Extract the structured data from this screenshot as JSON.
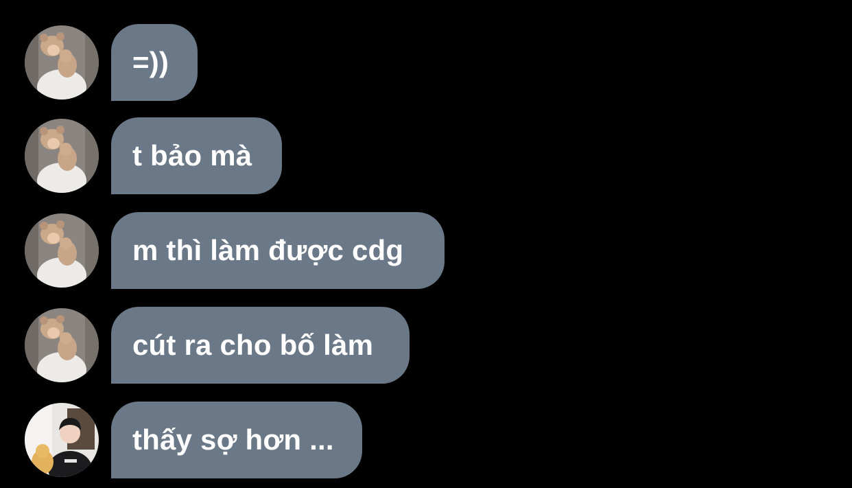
{
  "messages": [
    {
      "text": "=))",
      "avatar": "bear-hat-person-avatar"
    },
    {
      "text": "t bảo mà",
      "avatar": "bear-hat-person-avatar"
    },
    {
      "text": "m thì làm được cdg",
      "avatar": "bear-hat-person-avatar"
    },
    {
      "text": "cút ra cho bố làm",
      "avatar": "bear-hat-person-avatar"
    },
    {
      "text": "thấy sợ hơn ...",
      "avatar": "dark-shirt-person-avatar"
    }
  ],
  "colors": {
    "background": "#000000",
    "bubble": "#6b7887",
    "bubble_text": "#ffffff"
  }
}
